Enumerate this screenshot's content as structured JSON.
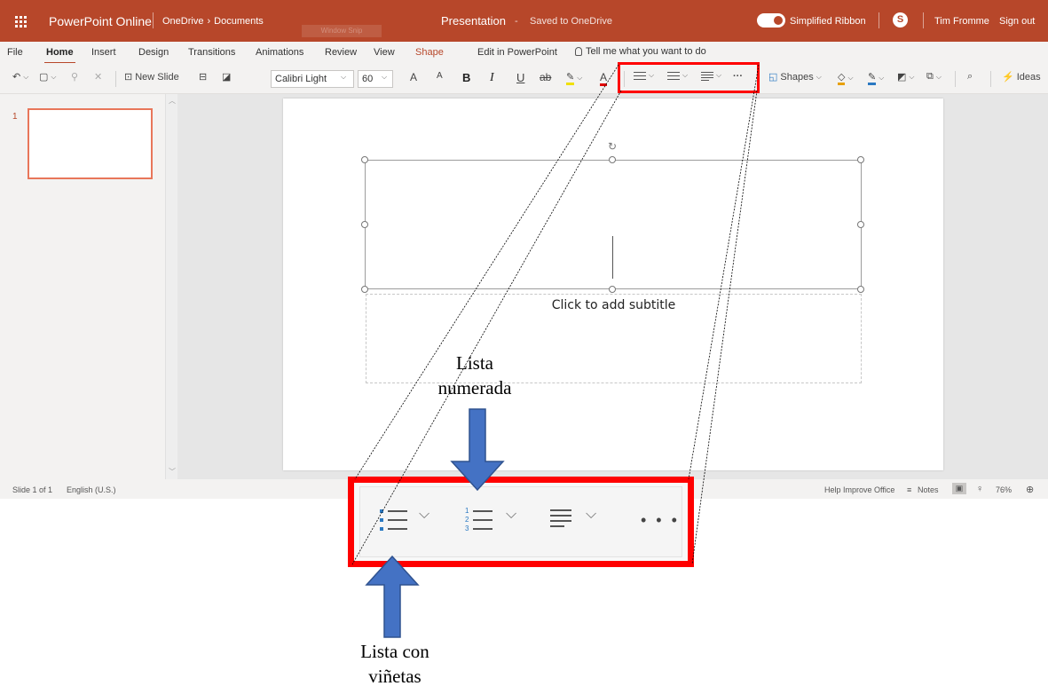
{
  "titlebar": {
    "app_name": "PowerPoint Online",
    "breadcrumb_root": "OneDrive",
    "breadcrumb_sep": "›",
    "breadcrumb_folder": "Documents",
    "window_snip": "Window Snip",
    "doc_title": "Presentation",
    "dash": "-",
    "saved_status": "Saved to OneDrive",
    "simplified_ribbon": "Simplified Ribbon",
    "skype_letter": "S",
    "user_name": "Tim Fromme",
    "sign_out": "Sign out",
    "brand_color": "#b7472a"
  },
  "menu": {
    "tabs": [
      "File",
      "Home",
      "Insert",
      "Design",
      "Transitions",
      "Animations",
      "Review",
      "View",
      "Shape",
      "Edit in PowerPoint"
    ],
    "active_tab": "Home",
    "tell_me": "Tell me what you want to do"
  },
  "ribbon": {
    "new_slide": "New Slide",
    "font_name": "Calibri Light",
    "font_size": "60",
    "grow_font": "A",
    "shrink_font": "A",
    "bold": "B",
    "italic": "I",
    "underline": "U",
    "strikethrough": "ab",
    "more": "···",
    "shapes": "Shapes",
    "ideas": "Ideas",
    "chevron": "⌵"
  },
  "thumbnails": {
    "slide_number": "1"
  },
  "slide": {
    "subtitle_placeholder": "Click to add subtitle"
  },
  "status": {
    "slide_count": "Slide 1 of 1",
    "language": "English (U.S.)",
    "help_improve": "Help Improve Office",
    "notes": "Notes",
    "zoom": "76%"
  },
  "callout": {
    "numbers": [
      "1",
      "2",
      "3"
    ],
    "more": "• • •",
    "label_numbered_line1": "Lista",
    "label_numbered_line2": "numerada",
    "label_bullets_line1": "Lista con",
    "label_bullets_line2": "viñetas",
    "highlight_color": "#ff0000",
    "arrow_color": "#4472c4"
  }
}
